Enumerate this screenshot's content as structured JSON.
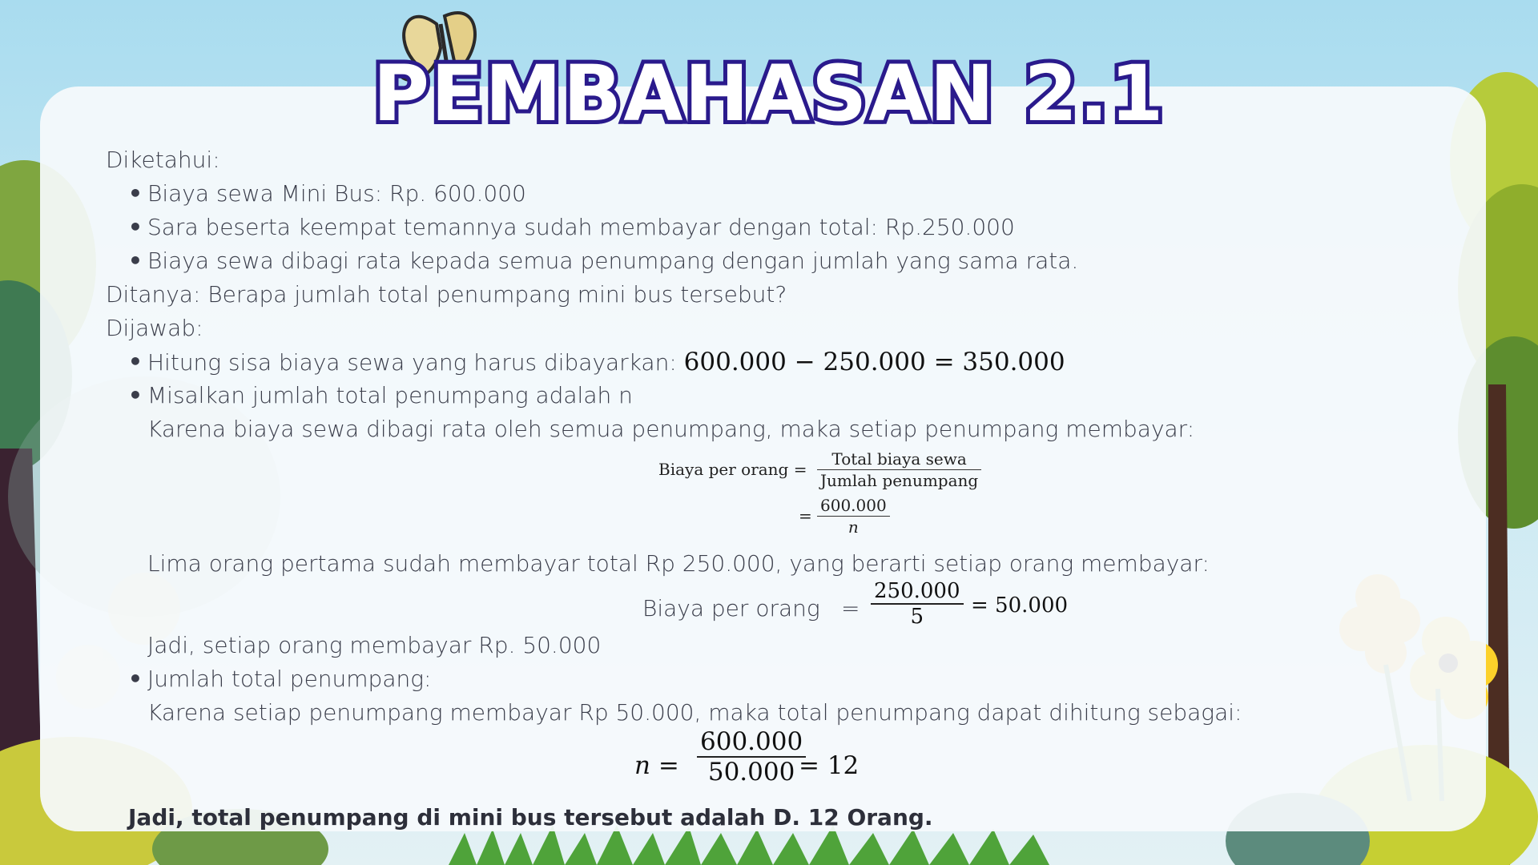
{
  "title": "PEMBAHASAN 2.1",
  "diketahui": {
    "label": "Diketahui:",
    "items": [
      "Biaya sewa Mini Bus: Rp. 600.000",
      "Sara beserta keempat temannya sudah membayar dengan total: Rp.250.000",
      "Biaya sewa dibagi rata kepada semua penumpang dengan jumlah yang sama rata."
    ]
  },
  "ditanya": "Ditanya: Berapa jumlah total penumpang mini bus tersebut?",
  "dijawab": {
    "label": "Dijawab:",
    "step1_text": "Hitung sisa biaya sewa yang harus dibayarkan:",
    "step1_math": "600.000 − 250.000 = 350.000",
    "step2_text": "Misalkan jumlah total penumpang adalah  n",
    "step2_explain": "Karena biaya sewa dibagi rata oleh semua penumpang, maka setiap penumpang membayar:",
    "formula": {
      "lhs": "Biaya per orang =",
      "num1": "Total biaya sewa",
      "den1": "Jumlah penumpang",
      "eq2": "=",
      "num2": "600.000",
      "den2": "n"
    },
    "step3_text": "Lima orang pertama sudah membayar total Rp 250.000, yang berarti setiap orang    membayar:",
    "formula2": {
      "lhs": "Biaya per orang",
      "eq": "=",
      "num": "250.000",
      "den": "5",
      "result": "= 50.000"
    },
    "step3_result": "Jadi, setiap orang membayar Rp. 50.000",
    "step4_text": "Jumlah total penumpang:",
    "step4_explain": "Karena setiap penumpang membayar Rp 50.000, maka total penumpang dapat dihitung sebagai:",
    "formula3": {
      "lhs": "n =",
      "num": "600.000",
      "den": "50.000",
      "result": "= 12"
    }
  },
  "conclusion": "Jadi, total penumpang di mini bus tersebut adalah D. 12 Orang.",
  "colors": {
    "title_fill": "#ffffff",
    "title_stroke": "#2a1a8c",
    "text": "#3a3d4a"
  },
  "decor_icons": [
    "butterfly-icon",
    "tree-icon",
    "flower-icon",
    "bush-icon",
    "grass-icon"
  ]
}
